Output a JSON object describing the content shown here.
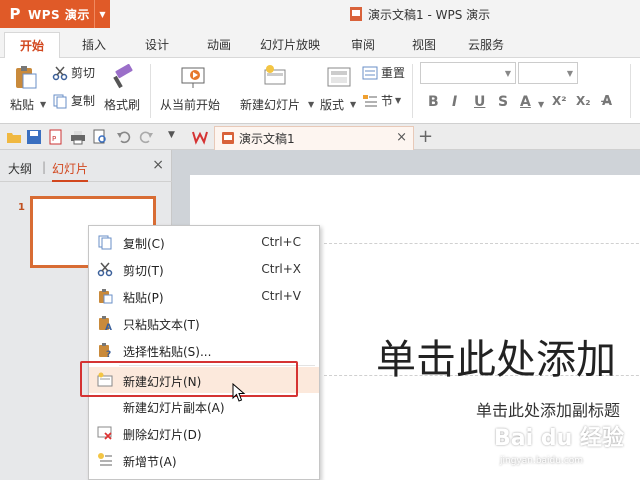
{
  "app": {
    "logo_glyph": "P",
    "name": "WPS 演示",
    "document_title": "演示文稿1 - WPS 演示"
  },
  "ribbon_tabs": [
    "开始",
    "插入",
    "设计",
    "动画",
    "幻灯片放映",
    "审阅",
    "视图",
    "云服务"
  ],
  "ribbon": {
    "paste": "粘贴",
    "cut": "剪切",
    "copy": "复制",
    "format_painter": "格式刷",
    "from_current": "从当前开始",
    "new_slide": "新建幻灯片",
    "layout": "版式",
    "reset": "重置",
    "section": "节"
  },
  "quick_access": {
    "doc_tab": "演示文稿1",
    "close_glyph": "×",
    "new_tab_glyph": "+"
  },
  "side_panel": {
    "tab_outline": "大纲",
    "tab_slides": "幻灯片",
    "close_glyph": "×",
    "slide_number": "1"
  },
  "slide": {
    "title_placeholder": "单击此处添加",
    "subtitle_placeholder": "单击此处添加副标题"
  },
  "context_menu": {
    "items": [
      {
        "label": "复制(C)",
        "shortcut": "Ctrl+C",
        "icon": "copy-icon"
      },
      {
        "label": "剪切(T)",
        "shortcut": "Ctrl+X",
        "icon": "scissors-icon"
      },
      {
        "label": "粘贴(P)",
        "shortcut": "Ctrl+V",
        "icon": "paste-icon"
      },
      {
        "label": "只粘贴文本(T)",
        "shortcut": "",
        "icon": "paste-text-icon"
      },
      {
        "label": "选择性粘贴(S)...",
        "shortcut": "",
        "icon": "paste-special-icon"
      },
      {
        "label": "新建幻灯片(N)",
        "shortcut": "",
        "icon": "new-slide-icon"
      },
      {
        "label": "新建幻灯片副本(A)",
        "shortcut": "",
        "icon": ""
      },
      {
        "label": "删除幻灯片(D)",
        "shortcut": "",
        "icon": "delete-slide-icon"
      },
      {
        "label": "新增节(A)",
        "shortcut": "",
        "icon": "new-section-icon"
      }
    ],
    "highlighted": "新建幻灯片(N)"
  },
  "watermark": {
    "logo": "Bai du 经验",
    "url": "jingyan.baidu.com"
  },
  "colors": {
    "brand": "#e05a28",
    "active_tab": "#d2471e",
    "highlight_box": "#d53333",
    "menu_highlight": "#fce9dc"
  }
}
